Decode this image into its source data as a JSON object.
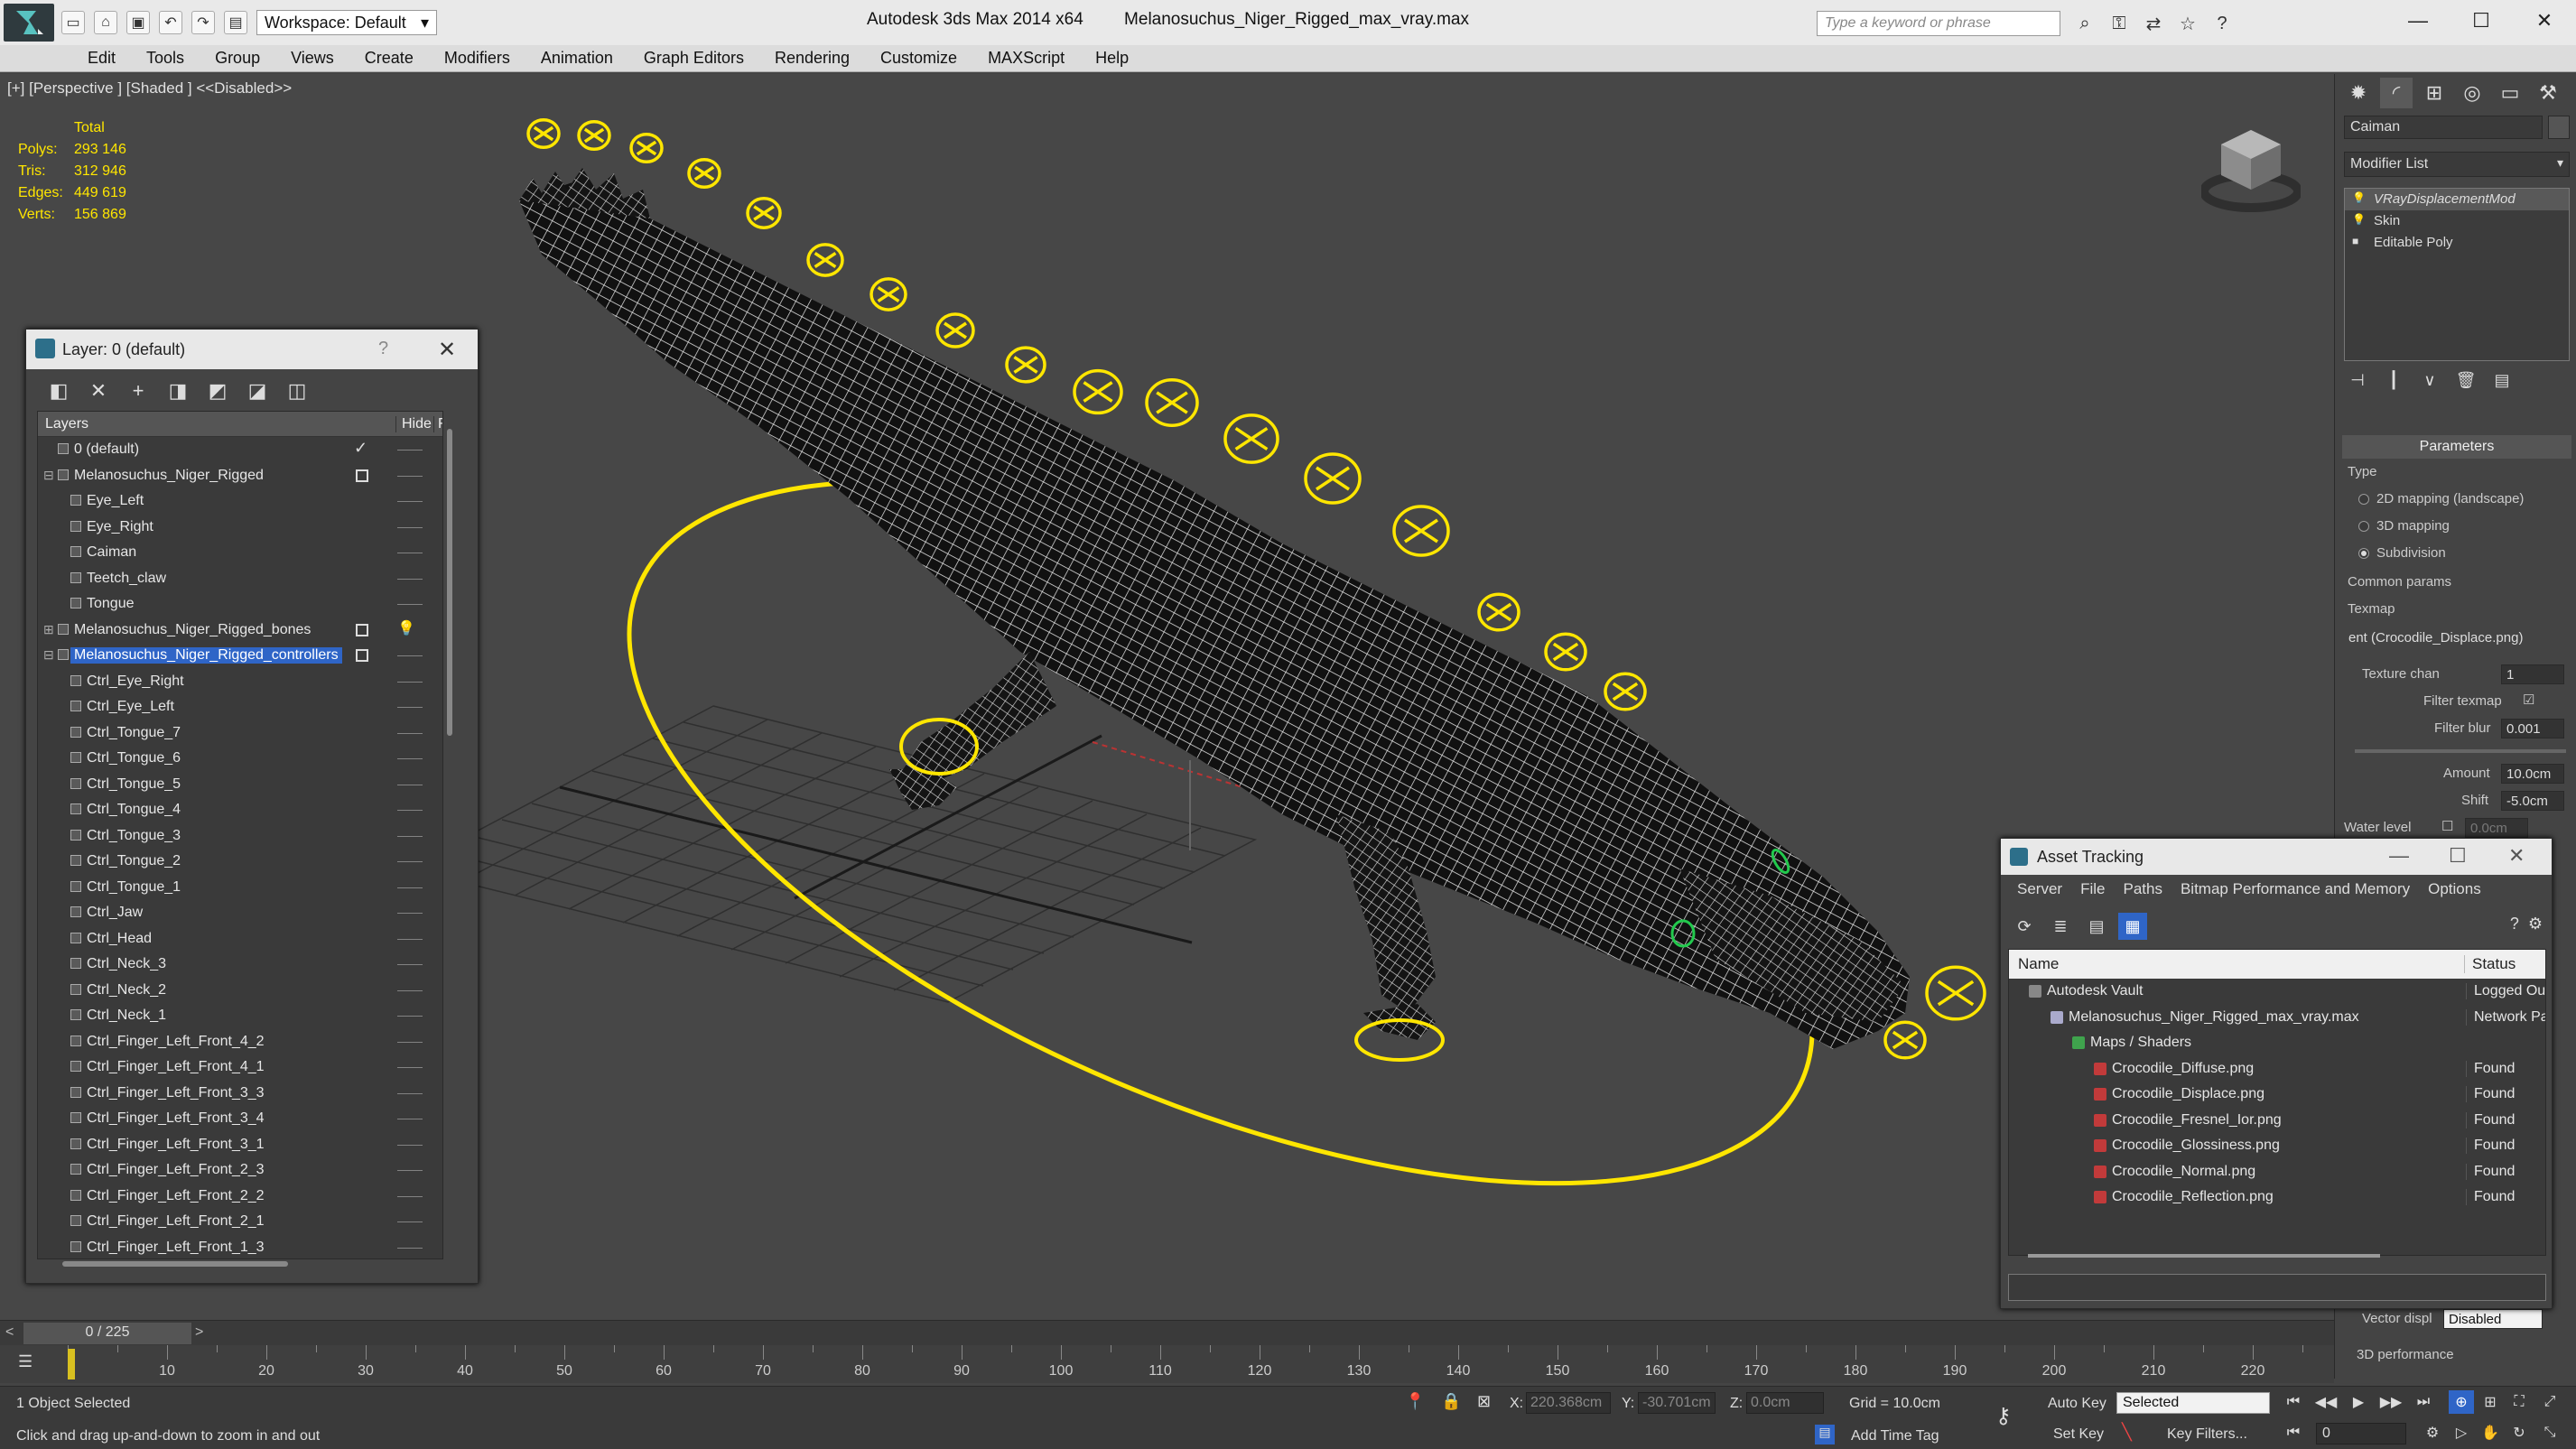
{
  "titlebar": {
    "workspace": "Workspace: Default",
    "app_name": "Autodesk 3ds Max  2014 x64",
    "file_name": "Melanosuchus_Niger_Rigged_max_vray.max",
    "search_placeholder": "Type a keyword or phrase"
  },
  "menu": [
    "Edit",
    "Tools",
    "Group",
    "Views",
    "Create",
    "Modifiers",
    "Animation",
    "Graph Editors",
    "Rendering",
    "Customize",
    "MAXScript",
    "Help"
  ],
  "viewport": {
    "label": "[+] [Perspective ] [Shaded ]  <<Disabled>>",
    "stats": {
      "total_label": "Total",
      "rows": [
        {
          "k": "Polys:",
          "v": "293 146"
        },
        {
          "k": "Tris:",
          "v": "312 946"
        },
        {
          "k": "Edges:",
          "v": "449 619"
        },
        {
          "k": "Verts:",
          "v": "156 869"
        }
      ]
    }
  },
  "layer_dialog": {
    "title": "Layer: 0 (default)",
    "help": "?",
    "col_layers": "Layers",
    "col_hide": "Hide",
    "col_f": "F",
    "rows": [
      {
        "name": "0 (default)",
        "level": 0,
        "marker": "check"
      },
      {
        "name": "Melanosuchus_Niger_Rigged",
        "level": 0,
        "marker": "box",
        "expand": "−"
      },
      {
        "name": "Eye_Left",
        "level": 1
      },
      {
        "name": "Eye_Right",
        "level": 1
      },
      {
        "name": "Caiman",
        "level": 1
      },
      {
        "name": "Teetch_claw",
        "level": 1
      },
      {
        "name": "Tongue",
        "level": 1
      },
      {
        "name": "Melanosuchus_Niger_Rigged_bones",
        "level": 0,
        "marker": "box",
        "expand": "+",
        "bulb": true
      },
      {
        "name": "Melanosuchus_Niger_Rigged_controllers",
        "level": 0,
        "marker": "box",
        "expand": "−",
        "selected": true
      },
      {
        "name": "Ctrl_Eye_Right",
        "level": 1
      },
      {
        "name": "Ctrl_Eye_Left",
        "level": 1
      },
      {
        "name": "Ctrl_Tongue_7",
        "level": 1
      },
      {
        "name": "Ctrl_Tongue_6",
        "level": 1
      },
      {
        "name": "Ctrl_Tongue_5",
        "level": 1
      },
      {
        "name": "Ctrl_Tongue_4",
        "level": 1
      },
      {
        "name": "Ctrl_Tongue_3",
        "level": 1
      },
      {
        "name": "Ctrl_Tongue_2",
        "level": 1
      },
      {
        "name": "Ctrl_Tongue_1",
        "level": 1
      },
      {
        "name": "Ctrl_Jaw",
        "level": 1
      },
      {
        "name": "Ctrl_Head",
        "level": 1
      },
      {
        "name": "Ctrl_Neck_3",
        "level": 1
      },
      {
        "name": "Ctrl_Neck_2",
        "level": 1
      },
      {
        "name": "Ctrl_Neck_1",
        "level": 1
      },
      {
        "name": "Ctrl_Finger_Left_Front_4_2",
        "level": 1
      },
      {
        "name": "Ctrl_Finger_Left_Front_4_1",
        "level": 1
      },
      {
        "name": "Ctrl_Finger_Left_Front_3_3",
        "level": 1
      },
      {
        "name": "Ctrl_Finger_Left_Front_3_4",
        "level": 1
      },
      {
        "name": "Ctrl_Finger_Left_Front_3_1",
        "level": 1
      },
      {
        "name": "Ctrl_Finger_Left_Front_2_3",
        "level": 1
      },
      {
        "name": "Ctrl_Finger_Left_Front_2_2",
        "level": 1
      },
      {
        "name": "Ctrl_Finger_Left_Front_2_1",
        "level": 1
      },
      {
        "name": "Ctrl_Finger_Left_Front_1_3",
        "level": 1
      }
    ]
  },
  "command_panel": {
    "object_name": "Caiman",
    "modifier_list": "Modifier List",
    "stack": [
      {
        "name": "VRayDisplacementMod",
        "selected": true
      },
      {
        "name": "Skin"
      },
      {
        "name": "Editable Poly"
      }
    ],
    "rollout": "Parameters",
    "type_label": "Type",
    "radio_options": [
      "2D mapping (landscape)",
      "3D mapping",
      "Subdivision"
    ],
    "common_params": "Common params",
    "texmap_label": "Texmap",
    "texmap_value": "ent (Crocodile_Displace.png)",
    "texture_chan_label": "Texture chan",
    "texture_chan_value": "1",
    "filter_texmap_label": "Filter texmap",
    "filter_blur_label": "Filter blur",
    "filter_blur_value": "0.001",
    "amount_label": "Amount",
    "amount_value": "10.0cm",
    "shift_label": "Shift",
    "shift_value": "-5.0cm",
    "water_level_label": "Water level",
    "water_level_value": "0.0cm",
    "vector_disp_label": "Vector displ",
    "vector_disp_value": "Disabled",
    "perf_label": "3D performance"
  },
  "asset_tracking": {
    "title": "Asset Tracking",
    "menu": [
      "Server",
      "File",
      "Paths",
      "Bitmap Performance and Memory",
      "Options"
    ],
    "col_name": "Name",
    "col_status": "Status",
    "rows": [
      {
        "name": "Autodesk Vault",
        "status": "Logged Out",
        "indent": 0,
        "icon": "vault"
      },
      {
        "name": "Melanosuchus_Niger_Rigged_max_vray.max",
        "status": "Network Pa",
        "indent": 1,
        "icon": "file"
      },
      {
        "name": "Maps / Shaders",
        "status": "",
        "indent": 2,
        "icon": "folder"
      },
      {
        "name": "Crocodile_Diffuse.png",
        "status": "Found",
        "indent": 3,
        "icon": "png"
      },
      {
        "name": "Crocodile_Displace.png",
        "status": "Found",
        "indent": 3,
        "icon": "png"
      },
      {
        "name": "Crocodile_Fresnel_Ior.png",
        "status": "Found",
        "indent": 3,
        "icon": "png"
      },
      {
        "name": "Crocodile_Glossiness.png",
        "status": "Found",
        "indent": 3,
        "icon": "png"
      },
      {
        "name": "Crocodile_Normal.png",
        "status": "Found",
        "indent": 3,
        "icon": "png"
      },
      {
        "name": "Crocodile_Reflection.png",
        "status": "Found",
        "indent": 3,
        "icon": "png"
      }
    ]
  },
  "timeline": {
    "frame_display": "0 / 225",
    "current_frame": 0,
    "ticks": [
      "10",
      "20",
      "30",
      "40",
      "50",
      "60",
      "70",
      "80",
      "90",
      "100",
      "110",
      "120",
      "130",
      "140",
      "150",
      "160",
      "170",
      "180",
      "190",
      "200",
      "210",
      "220"
    ]
  },
  "status": {
    "selection": "1 Object Selected",
    "prompt": "Click and drag up-and-down to zoom in and out",
    "x_label": "X:",
    "x_value": "220.368cm",
    "y_label": "Y:",
    "y_value": "-30.701cm",
    "z_label": "Z:",
    "z_value": "0.0cm",
    "grid": "Grid = 10.0cm",
    "add_time_tag": "Add Time Tag",
    "auto_key": "Auto Key",
    "set_key": "Set Key",
    "selected_dropdown": "Selected",
    "key_filters": "Key Filters...",
    "frame": "0"
  },
  "colors": {
    "controller_yellow": "#ffe600",
    "selection_blue": "#2f65c7",
    "viewport_bg": "#474747"
  }
}
